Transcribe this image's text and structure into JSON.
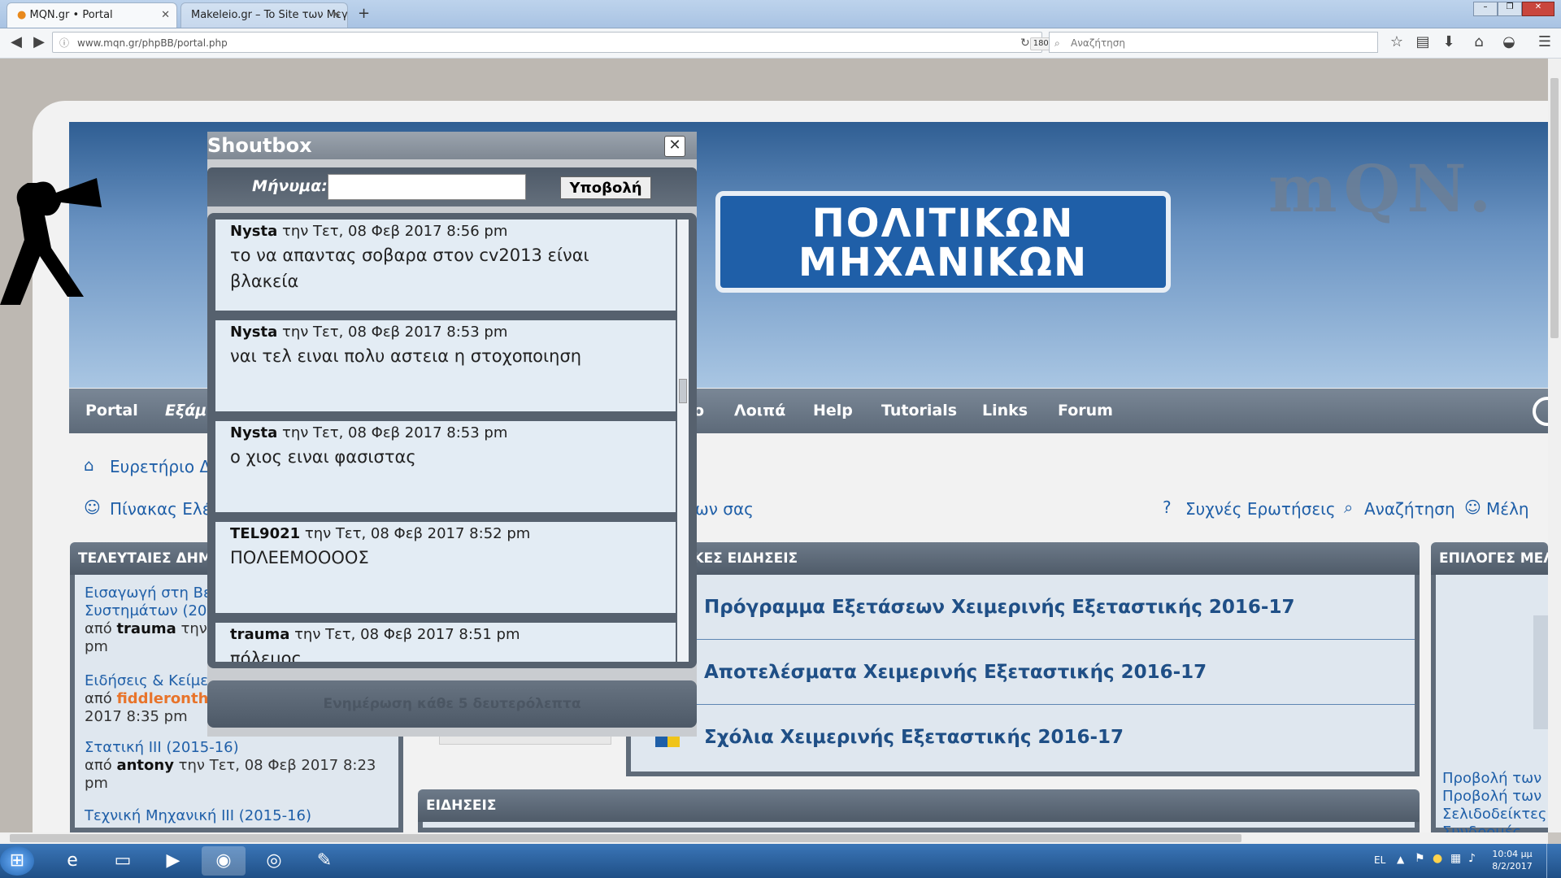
{
  "browser": {
    "tabs": [
      {
        "label": "MQN.gr • Portal",
        "active": true
      },
      {
        "label": "Makeleio.gr – To Site των Μεγ...",
        "active": false
      }
    ],
    "new_tab": "+",
    "url": "www.mqn.gr/phpBB/portal.php",
    "zoom": "180%",
    "search_placeholder": "Αναζήτηση"
  },
  "site": {
    "sign_text_line1": "ΠΟΛΙΤΙΚΩΝ",
    "sign_text_line2": "ΜΗΧΑΝΙΚΩΝ",
    "logo_text": "mQN."
  },
  "menu": [
    "Portal",
    "Εξάμ",
    "ο",
    "Λοιπά",
    "Help",
    "Tutorials",
    "Links",
    "Forum"
  ],
  "crumbs": {
    "home": "Ευρετήριο Δ",
    "control_panel": "Πίνακας Ελέ",
    "ending": "ων σας",
    "faq": "Συχνές Ερωτήσεις",
    "search": "Αναζήτηση",
    "members": "Μέλη"
  },
  "left_panel": {
    "title": "ΤΕΛΕΥΤΑΙΕΣ ΔΗΜ",
    "items": [
      {
        "line1": "Εισαγωγή στη Βε",
        "line2": "Συστημάτων (20",
        "by": "από",
        "user": "trauma",
        "tail": "την",
        "line3": "pm"
      },
      {
        "line1": "Ειδήσεις & Κείμε",
        "by": "από",
        "user": "fiddleronth",
        "line3": "2017 8:35 pm"
      },
      {
        "line1": "Στατική ΙΙΙ (2015-16)",
        "by": "από",
        "user": "antony",
        "tail": "την Τετ, 08 Φεβ 2017 8:23",
        "line3": "pm"
      },
      {
        "line1": "Τεχνική Μηχανική ΙΙΙ (2015-16)"
      }
    ]
  },
  "news_panel": {
    "title": "ΙΚΕΣ ΕΙΔΗΣΕΙΣ",
    "items": [
      "Πρόγραμμα Εξετάσεων Χειμερινής Εξεταστικής 2016-17",
      "Αποτελέσματα Χειμερινής Εξεταστικής 2016-17",
      "Σχόλια Χειμερινής Εξεταστικής 2016-17"
    ]
  },
  "news2_panel": {
    "title": "ΕΙΔΗΣΕΙΣ"
  },
  "right_panel": {
    "title": "ΕΠΙΛΟΓΕΣ ΜΕΛ",
    "links": [
      "Προβολή των",
      "Προβολή των",
      "Σελιδοδείκτες",
      "Συνδρομές"
    ]
  },
  "shoutbox": {
    "title": "Shoutbox",
    "message_label": "Μήνυμα:",
    "message_value": "",
    "submit_label": "Υποβολή",
    "messages": [
      {
        "user": "Nysta",
        "when": "την Τετ, 08 Φεβ 2017 8:56 pm",
        "text": "το να απαντας σοβαρα στον cv2013 είναι βλακεία"
      },
      {
        "user": "Nysta",
        "when": "την Τετ, 08 Φεβ 2017 8:53 pm",
        "text": "ναι τελ ειναι πολυ αστεια η στοχοποιηση"
      },
      {
        "user": "Nysta",
        "when": "την Τετ, 08 Φεβ 2017 8:53 pm",
        "text": "ο χιος ειναι φασιστας"
      },
      {
        "user": "TEL9021",
        "when": "την Τετ, 08 Φεβ 2017 8:52 pm",
        "text": "ΠΟΛΕΕΜΟΟΟΟΣ"
      },
      {
        "user": "trauma",
        "when": "την Τετ, 08 Φεβ 2017 8:51 pm",
        "text": "πόλεμος"
      }
    ],
    "footer": "Ενημέρωση κάθε 5 δευτερόλεπτα"
  },
  "taskbar": {
    "lang": "EL",
    "time": "10:04 μμ",
    "date": "8/2/2017"
  }
}
